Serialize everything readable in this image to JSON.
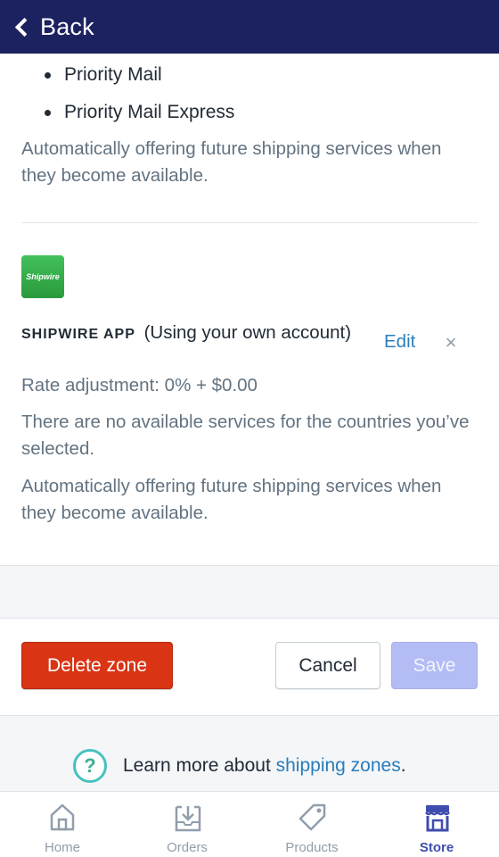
{
  "header": {
    "back_label": "Back"
  },
  "services": {
    "items": [
      "Priority Mail",
      "Priority Mail Express"
    ],
    "auto_note": "Automatically offering future shipping services when they become available."
  },
  "carrier": {
    "logo_text": "Shipwire",
    "name": "SHIPWIRE APP",
    "account_note": "(Using your own account)",
    "rate_adjustment": "Rate adjustment: 0% + $0.00",
    "edit_label": "Edit",
    "remove_label": "×",
    "no_services_note": "There are no available services for the countries you’ve selected.",
    "auto_note": "Automatically offering future shipping services when they become available."
  },
  "actions": {
    "delete_label": "Delete zone",
    "cancel_label": "Cancel",
    "save_label": "Save"
  },
  "learn_more": {
    "prefix": "Learn more about ",
    "link": "shipping zones",
    "suffix": "."
  },
  "tabbar": {
    "items": [
      {
        "label": "Home",
        "icon": "home-icon"
      },
      {
        "label": "Orders",
        "icon": "orders-icon"
      },
      {
        "label": "Products",
        "icon": "tag-icon"
      },
      {
        "label": "Store",
        "icon": "store-icon"
      }
    ],
    "active": "Store"
  },
  "colors": {
    "topbar": "#1c2260",
    "delete": "#d93515",
    "save_disabled": "#b3bcf5",
    "link": "#2a7dbb",
    "active_tab": "#3f4eae"
  }
}
